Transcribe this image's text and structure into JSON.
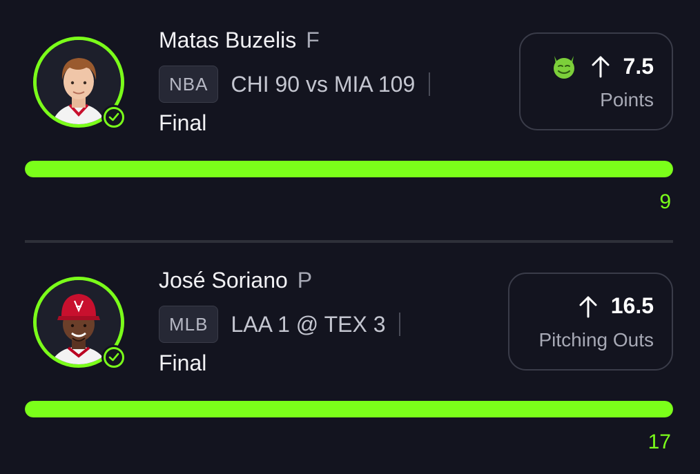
{
  "colors": {
    "background": "#13141f",
    "accent": "#7bff1a",
    "muted_text": "#a7a9b5",
    "box_border": "#3a3c49"
  },
  "picks": [
    {
      "player_name": "Matas Buzelis",
      "position": "F",
      "league": "NBA",
      "game": "CHI 90 vs MIA 109",
      "status": "Final",
      "badge_icon": "demon-face-icon",
      "direction_icon": "arrow-up-icon",
      "line": "7.5",
      "stat": "Points",
      "actual": "9",
      "progress": 1.0,
      "result": "hit"
    },
    {
      "player_name": "José Soriano",
      "position": "P",
      "league": "MLB",
      "game": "LAA 1 @ TEX 3",
      "status": "Final",
      "direction_icon": "arrow-up-icon",
      "line": "16.5",
      "stat": "Pitching Outs",
      "actual": "17",
      "progress": 1.0,
      "result": "hit"
    }
  ]
}
